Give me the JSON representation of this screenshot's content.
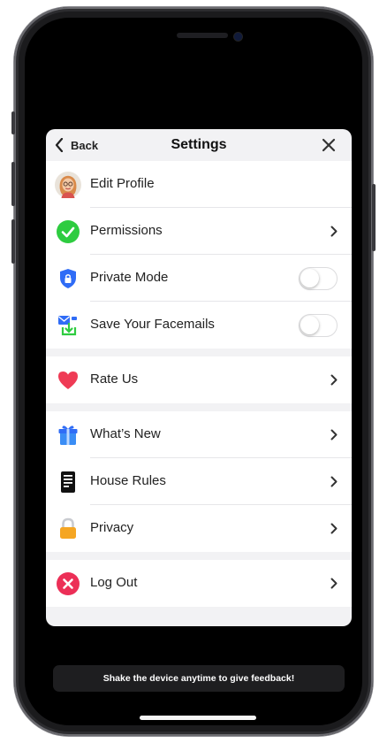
{
  "header": {
    "back_label": "Back",
    "title": "Settings"
  },
  "groups": [
    {
      "rows": [
        {
          "label": "Edit Profile",
          "icon": "avatar-icon"
        },
        {
          "label": "Permissions",
          "icon": "checkmark-circle-icon",
          "accessory": "chevron"
        },
        {
          "label": "Private Mode",
          "icon": "shield-icon",
          "accessory": "toggle",
          "toggle_on": false
        },
        {
          "label": "Save Your Facemails",
          "icon": "save-download-icon",
          "accessory": "toggle",
          "toggle_on": false
        }
      ]
    },
    {
      "rows": [
        {
          "label": "Rate Us",
          "icon": "heart-icon",
          "accessory": "chevron"
        }
      ]
    },
    {
      "rows": [
        {
          "label": "What’s New",
          "icon": "gift-icon",
          "accessory": "chevron"
        },
        {
          "label": "House Rules",
          "icon": "document-icon",
          "accessory": "chevron"
        },
        {
          "label": "Privacy",
          "icon": "lock-icon",
          "accessory": "chevron"
        }
      ]
    },
    {
      "rows": [
        {
          "label": "Log Out",
          "icon": "logout-x-icon",
          "accessory": "chevron"
        }
      ]
    }
  ],
  "feedback_banner": "Shake the device anytime to give feedback!",
  "colors": {
    "permissions_green": "#2ecc40",
    "shield_blue": "#2f6cf6",
    "heart_red": "#ef3b55",
    "lock_orange": "#f5a623",
    "logout_red": "#ec2f57"
  }
}
